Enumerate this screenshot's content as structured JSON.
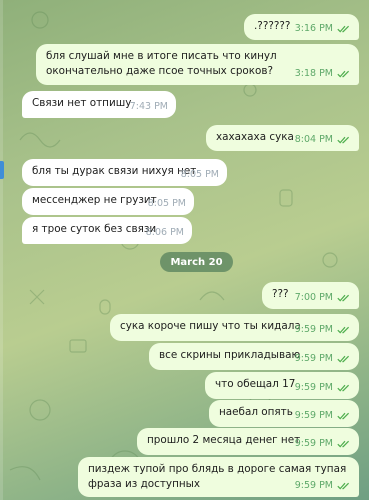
{
  "colors": {
    "outgoing_bubble": "#effdde",
    "incoming_bubble": "#ffffff",
    "outgoing_time": "#5fa96a",
    "read_checks": "#4fae4e",
    "date_pill": "#56805c"
  },
  "date_separator": "March 20",
  "messages": [
    {
      "dir": "out",
      "text": ".??????",
      "time": "3:16 PM",
      "read": true
    },
    {
      "dir": "out",
      "text": "бля слушай мне в итоге писать что кинул окончательно даже псое точных сроков?",
      "time": "3:18 PM",
      "read": true
    },
    {
      "dir": "in",
      "text": "Связи нет отпишу",
      "time": "7:43 PM"
    },
    {
      "dir": "out",
      "text": "хахахаха сука",
      "time": "8:04 PM",
      "read": true
    },
    {
      "dir": "in",
      "text": "бля ты дурак связи нихуя нет",
      "time": "8:05 PM"
    },
    {
      "dir": "in",
      "text": "мессенджер не грузит",
      "time": "8:05 PM"
    },
    {
      "dir": "in",
      "text": "я трое суток без связи",
      "time": "8:06 PM"
    },
    {
      "dir": "out",
      "text": "???",
      "time": "7:00 PM",
      "read": true
    },
    {
      "dir": "out",
      "text": "сука короче пишу что ты кидала",
      "time": "9:59 PM",
      "read": true
    },
    {
      "dir": "out",
      "text": "все скрины прикладываю",
      "time": "9:59 PM",
      "read": true
    },
    {
      "dir": "out",
      "text": "что обещал 17",
      "time": "9:59 PM",
      "read": true
    },
    {
      "dir": "out",
      "text": "наебал опять",
      "time": "9:59 PM",
      "read": true
    },
    {
      "dir": "out",
      "text": "прошло 2 месяца денег нет",
      "time": "9:59 PM",
      "read": true
    },
    {
      "dir": "out",
      "text": "пиздеж тупой про блядь в дороге самая тупая фраза из доступных",
      "time": "9:59 PM",
      "read": true
    }
  ]
}
